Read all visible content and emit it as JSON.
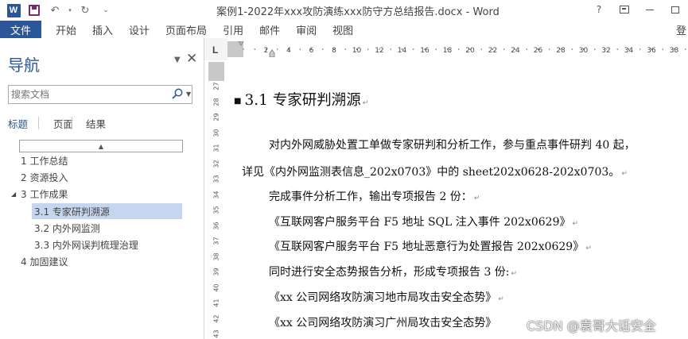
{
  "window": {
    "title": "案例1-2022年xxx攻防演练xxx防守方总结报告.docx - Word",
    "help": "?",
    "signin": "登"
  },
  "qat": {
    "app_logo": "W"
  },
  "ribbon_tabs": [
    "文件",
    "开始",
    "插入",
    "设计",
    "页面布局",
    "引用",
    "邮件",
    "审阅",
    "视图"
  ],
  "nav": {
    "title": "导航",
    "search_placeholder": "搜索文档",
    "tabs": [
      "标题",
      "页面",
      "结果"
    ],
    "headings": [
      {
        "label": "1 工作总结",
        "level": 1,
        "expander": ""
      },
      {
        "label": "2 资源投入",
        "level": 1,
        "expander": ""
      },
      {
        "label": "3 工作成果",
        "level": 1,
        "expander": "◢"
      },
      {
        "label": "3.1 专家研判溯源",
        "level": 2,
        "expander": "",
        "selected": true
      },
      {
        "label": "3.2 内外网监测",
        "level": 2,
        "expander": ""
      },
      {
        "label": "3.3 内外网误判梳理治理",
        "level": 2,
        "expander": ""
      },
      {
        "label": "4 加固建议",
        "level": 1,
        "expander": ""
      }
    ]
  },
  "ruler": {
    "corner": "L",
    "horizontal_numbers": [
      "2",
      "4",
      "6",
      "8",
      "10",
      "12",
      "14",
      "16",
      "18",
      "20",
      "22",
      "24",
      "26",
      "28",
      "30",
      "32",
      "34",
      "36",
      "38"
    ],
    "vertical_numbers": [
      "27",
      "28",
      "29",
      "30",
      "31",
      "32",
      "33",
      "34",
      "35",
      "36",
      "37",
      "38",
      "39",
      "40",
      "41",
      "42",
      "43"
    ]
  },
  "document": {
    "heading": "3.1  专家研判溯源",
    "paragraphs": [
      "对内外网威胁处置工单做专家研判和分析工作，参与重点事件研判 40 起，",
      "详见《内外网监测表信息_202x0703》中的 sheet202x0628-202x0703。",
      "完成事件分析工作，输出专项报告 2 份：",
      "《互联网客户服务平台 F5 地址 SQL 注入事件 202x0629》",
      "《互联网客户服务平台 F5 地址恶意行为处置报告 202x0629》",
      "同时进行安全态势报告分析，形成专项报告 3 份:",
      "《xx 公司网络攻防演习地市局攻击安全态势》",
      "《xx 公司网络攻防演习广州局攻击安全态势》"
    ]
  },
  "watermark": "CSDN @袁哥大话安全"
}
